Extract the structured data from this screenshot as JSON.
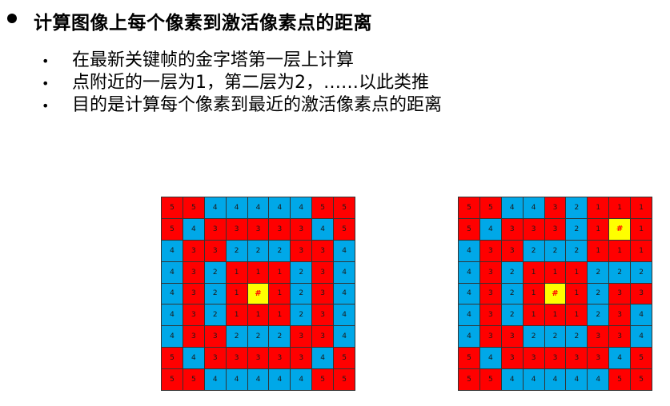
{
  "title": "计算图像上每个像素到激活像素点的距离",
  "bullets": [
    "在最新关键帧的金字塔第一层上计算",
    "点附近的一层为1，第二层为2，……以此类推",
    "目的是计算每个像素到最近的激活像素点的距离"
  ],
  "bullet_symbol": "•",
  "colors": {
    "red": "#ff0000",
    "blue": "#00a8e8",
    "yellow": "#ffff00"
  },
  "grids": [
    {
      "values": [
        [
          "5",
          "5",
          "4",
          "4",
          "4",
          "4",
          "4",
          "5",
          "5"
        ],
        [
          "5",
          "4",
          "3",
          "3",
          "3",
          "3",
          "3",
          "4",
          "5"
        ],
        [
          "4",
          "3",
          "3",
          "2",
          "2",
          "2",
          "3",
          "3",
          "4"
        ],
        [
          "4",
          "3",
          "2",
          "1",
          "1",
          "1",
          "2",
          "3",
          "4"
        ],
        [
          "4",
          "3",
          "2",
          "1",
          "#",
          "1",
          "2",
          "3",
          "4"
        ],
        [
          "4",
          "3",
          "2",
          "1",
          "1",
          "1",
          "2",
          "3",
          "4"
        ],
        [
          "4",
          "3",
          "3",
          "2",
          "2",
          "2",
          "3",
          "3",
          "4"
        ],
        [
          "5",
          "4",
          "3",
          "3",
          "3",
          "3",
          "3",
          "4",
          "5"
        ],
        [
          "5",
          "5",
          "4",
          "4",
          "4",
          "4",
          "4",
          "5",
          "5"
        ]
      ]
    },
    {
      "values": [
        [
          "5",
          "5",
          "4",
          "4",
          "3",
          "2",
          "1",
          "1",
          "1"
        ],
        [
          "5",
          "4",
          "3",
          "3",
          "3",
          "2",
          "1",
          "#",
          "1"
        ],
        [
          "4",
          "3",
          "3",
          "2",
          "2",
          "2",
          "1",
          "1",
          "1"
        ],
        [
          "4",
          "3",
          "2",
          "1",
          "1",
          "1",
          "2",
          "2",
          "2"
        ],
        [
          "4",
          "3",
          "2",
          "1",
          "#",
          "1",
          "2",
          "3",
          "3"
        ],
        [
          "4",
          "3",
          "2",
          "1",
          "1",
          "1",
          "2",
          "3",
          "4"
        ],
        [
          "4",
          "3",
          "3",
          "2",
          "2",
          "2",
          "3",
          "3",
          "4"
        ],
        [
          "5",
          "4",
          "3",
          "3",
          "3",
          "3",
          "3",
          "4",
          "5"
        ],
        [
          "5",
          "5",
          "4",
          "4",
          "4",
          "4",
          "4",
          "5",
          "5"
        ]
      ]
    }
  ]
}
